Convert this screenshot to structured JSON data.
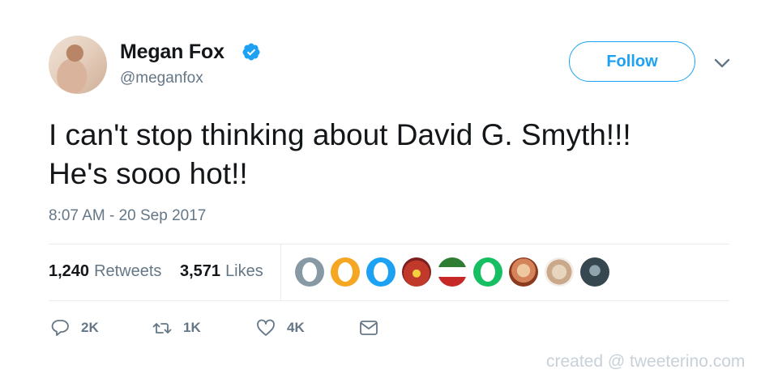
{
  "user": {
    "name": "Megan Fox",
    "handle": "@meganfox"
  },
  "follow_button": {
    "label": "Follow"
  },
  "tweet": {
    "line1": "I can't stop thinking about David G. Smyth!!!",
    "line2": "He's sooo hot!!",
    "timestamp": "8:07 AM - 20 Sep 2017"
  },
  "stats": {
    "retweets_count": "1,240",
    "retweets_label": "Retweets",
    "likes_count": "3,571",
    "likes_label": "Likes"
  },
  "likers": [
    {
      "icon": "egg-avatar-icon",
      "color": "#8899a6"
    },
    {
      "icon": "egg-avatar-icon",
      "color": "#f5a623"
    },
    {
      "icon": "egg-avatar-icon",
      "color": "#1da1f2"
    },
    {
      "icon": "photo-avatar",
      "color": "#c0392b"
    },
    {
      "icon": "flag-avatar",
      "color": "#2e7d32"
    },
    {
      "icon": "egg-avatar-icon",
      "color": "#17bf63"
    },
    {
      "icon": "photo-avatar",
      "color": "#d4835a"
    },
    {
      "icon": "photo-avatar",
      "color": "#c9a98a"
    },
    {
      "icon": "photo-avatar",
      "color": "#37474f"
    }
  ],
  "actions": {
    "reply_count": "2K",
    "retweet_count": "1K",
    "like_count": "4K"
  },
  "watermark": "created @ tweeterino.com",
  "colors": {
    "brand": "#1da1f2",
    "text": "#14171a",
    "secondary": "#657786",
    "divider": "#e6ecf0"
  }
}
